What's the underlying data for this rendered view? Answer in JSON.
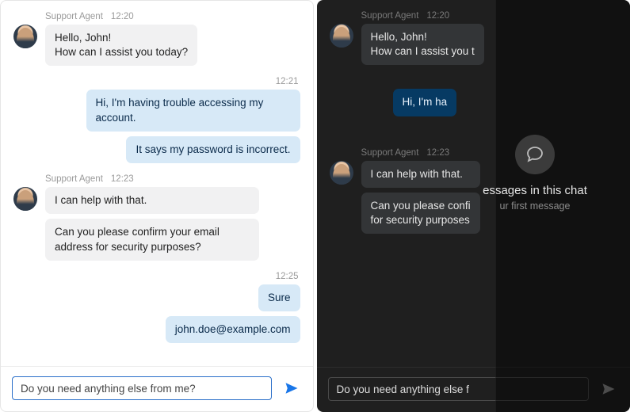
{
  "agent_name": "Support Agent",
  "messages": {
    "g1_time": "12:20",
    "g1_bubble": "Hello, John!\nHow can I assist you today?",
    "g2_time": "12:21",
    "g2_b1": "Hi, I'm having trouble accessing my account.",
    "g2_b2": "It says my password is incorrect.",
    "g3_time": "12:23",
    "g3_b1": "I can help with that.",
    "g3_b2": "Can you please confirm your email address for security purposes?",
    "g4_time": "12:25",
    "g4_b1": "Sure",
    "g4_b2": "john.doe@example.com"
  },
  "dark_truncated": {
    "g1_bubble": "Hello, John!\nHow can I assist you t",
    "g2_b1": "Hi, I'm ha",
    "g3_b2": "Can you please confi\nfor security purposes"
  },
  "input": {
    "value": "Do you need anything else from me?",
    "value_dark": "Do you need anything else f"
  },
  "empty_state": {
    "title_visible": "essages in this chat",
    "subtitle_visible": "ur first message"
  }
}
